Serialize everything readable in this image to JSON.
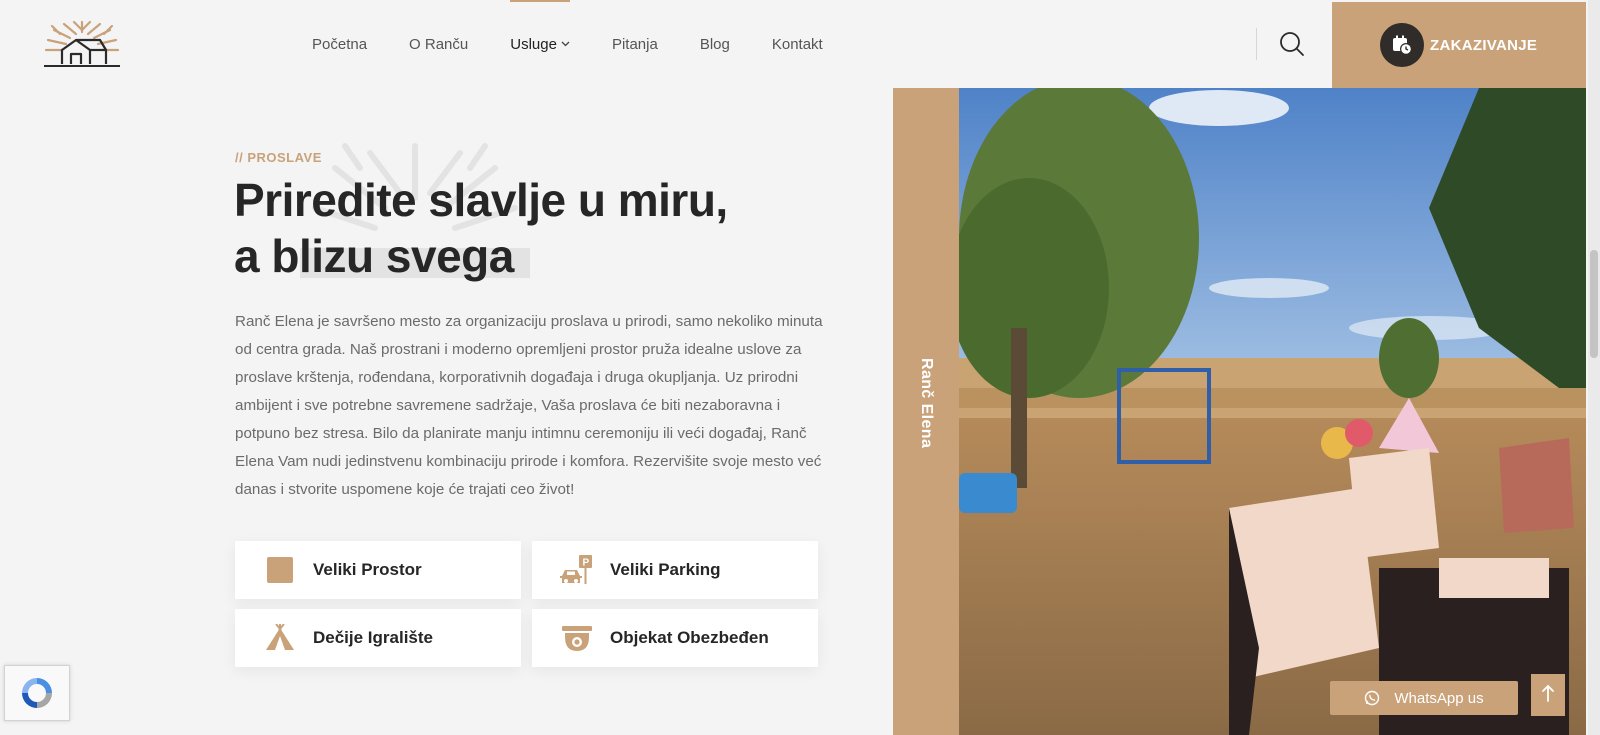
{
  "brand": {
    "logo_icon": "ranch-house-tree-logo"
  },
  "nav": {
    "items": [
      {
        "label": "Početna",
        "active": false
      },
      {
        "label": "O Ranču",
        "active": false
      },
      {
        "label": "Usluge",
        "active": true,
        "has_dropdown": true
      },
      {
        "label": "Pitanja",
        "active": false
      },
      {
        "label": "Blog",
        "active": false
      },
      {
        "label": "Kontakt",
        "active": false
      }
    ],
    "chevron": "⌵"
  },
  "header": {
    "search_icon": "search-icon",
    "booking_label": "ZAKAZIVANJE",
    "booking_icon": "calendar-clock-icon"
  },
  "hero": {
    "eyebrow": "// PROSLAVE",
    "title_line1": "Priredite slavlje u miru,",
    "title_line2": "a blizu svega",
    "paragraph": "Ranč Elena je savršeno mesto za organizaciju proslava u prirodi, samo nekoliko minuta od centra grada. Naš prostrani i moderno opremljeni prostor pruža idealne uslove za proslave krštenja, rođendana, korporativnih događaja i druga okupljanja. Uz prirodni ambijent i sve potrebne savremene sadržaje, Vaša proslava će biti nezaboravna i potpuno bez stresa. Bilo da planirate manju intimnu ceremoniju ili veći događaj, Ranč Elena Vam nudi jedinstvenu kombinaciju prirode i komfora. Rezervišite svoje mesto već danas i stvorite uspomene koje će trajati ceo život!"
  },
  "features": [
    {
      "label": "Veliki Prostor",
      "icon": "square-area-icon"
    },
    {
      "label": "Veliki Parking",
      "icon": "parking-icon"
    },
    {
      "label": "Dečije Igralište",
      "icon": "tent-icon"
    },
    {
      "label": "Objekat Obezbeđen",
      "icon": "security-camera-icon"
    }
  ],
  "side": {
    "label": "Ranč Elena"
  },
  "floating": {
    "whatsapp_label": "WhatsApp us",
    "scroll_top_icon": "arrow-up-icon"
  },
  "colors": {
    "accent": "#c9a27a",
    "dark": "#2f2c29",
    "background": "#f4f4f4",
    "text_muted": "#6b6b6b"
  }
}
